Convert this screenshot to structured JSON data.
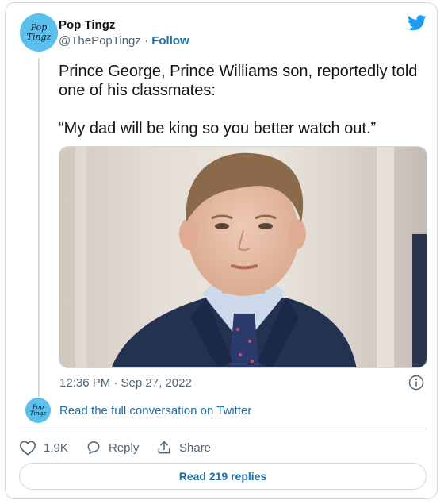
{
  "author": {
    "name": "Pop Tingz",
    "handle": "@ThePopTingz",
    "separator": "·",
    "follow_label": "Follow",
    "avatar_text": "Pop Tingz"
  },
  "tweet": {
    "text_line": "Prince George, Prince Williams son, reportedly told one of his classmates:",
    "quote": "“My dad will be king so you better watch out.”",
    "timestamp": "12:36 PM · Sep 27, 2022",
    "media_icon": "photo-of-boy-in-suit"
  },
  "conversation": {
    "label": "Read the full conversation on Twitter"
  },
  "actions": {
    "likes": "1.9K",
    "reply_label": "Reply",
    "share_label": "Share"
  },
  "replies_button": "Read 219 replies",
  "colors": {
    "twitter_blue": "#1d9bf0",
    "link_blue": "#1d6fa5",
    "avatar_bg": "#5bc0eb",
    "muted": "#536471",
    "border": "#cfd9de"
  }
}
